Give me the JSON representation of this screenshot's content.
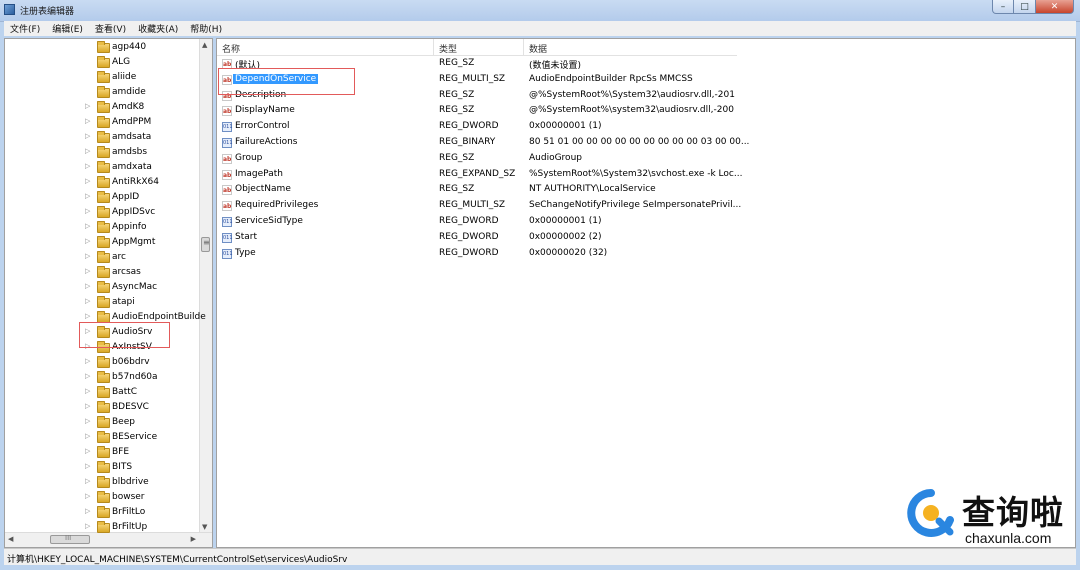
{
  "window": {
    "title": "注册表编辑器",
    "min_symbol": "–",
    "max_symbol": "□",
    "close_symbol": "✕"
  },
  "menu": [
    "文件(F)",
    "编辑(E)",
    "查看(V)",
    "收藏夹(A)",
    "帮助(H)"
  ],
  "tree": {
    "items": [
      {
        "label": "agp440",
        "expandable": false
      },
      {
        "label": "ALG",
        "expandable": false
      },
      {
        "label": "aliide",
        "expandable": false
      },
      {
        "label": "amdide",
        "expandable": false
      },
      {
        "label": "AmdK8",
        "expandable": true
      },
      {
        "label": "AmdPPM",
        "expandable": true
      },
      {
        "label": "amdsata",
        "expandable": true
      },
      {
        "label": "amdsbs",
        "expandable": true
      },
      {
        "label": "amdxata",
        "expandable": true
      },
      {
        "label": "AntiRkX64",
        "expandable": true
      },
      {
        "label": "AppID",
        "expandable": true
      },
      {
        "label": "AppIDSvc",
        "expandable": true
      },
      {
        "label": "Appinfo",
        "expandable": true
      },
      {
        "label": "AppMgmt",
        "expandable": true
      },
      {
        "label": "arc",
        "expandable": true
      },
      {
        "label": "arcsas",
        "expandable": true
      },
      {
        "label": "AsyncMac",
        "expandable": true
      },
      {
        "label": "atapi",
        "expandable": true
      },
      {
        "label": "AudioEndpointBuilde",
        "expandable": true
      },
      {
        "label": "AudioSrv",
        "expandable": true
      },
      {
        "label": "AxInstSV",
        "expandable": true
      },
      {
        "label": "b06bdrv",
        "expandable": true
      },
      {
        "label": "b57nd60a",
        "expandable": true
      },
      {
        "label": "BattC",
        "expandable": true
      },
      {
        "label": "BDESVC",
        "expandable": true
      },
      {
        "label": "Beep",
        "expandable": true
      },
      {
        "label": "BEService",
        "expandable": true
      },
      {
        "label": "BFE",
        "expandable": true
      },
      {
        "label": "BITS",
        "expandable": true
      },
      {
        "label": "blbdrive",
        "expandable": true
      },
      {
        "label": "bowser",
        "expandable": true
      },
      {
        "label": "BrFiltLo",
        "expandable": true
      },
      {
        "label": "BrFiltUp",
        "expandable": true
      }
    ],
    "scroll_up": "▲",
    "scroll_down": "▼",
    "scroll_left": "◀",
    "scroll_right": "▶"
  },
  "values": {
    "columns": [
      "名称",
      "类型",
      "数据"
    ],
    "rows": [
      {
        "name": "(默认)",
        "type": "REG_SZ",
        "data": "(数值未设置)",
        "icon": "ab"
      },
      {
        "name": "DependOnService",
        "type": "REG_MULTI_SZ",
        "data": "AudioEndpointBuilder RpcSs MMCSS",
        "icon": "ab"
      },
      {
        "name": "Description",
        "type": "REG_SZ",
        "data": "@%SystemRoot%\\System32\\audiosrv.dll,-201",
        "icon": "ab"
      },
      {
        "name": "DisplayName",
        "type": "REG_SZ",
        "data": "@%SystemRoot%\\system32\\audiosrv.dll,-200",
        "icon": "ab"
      },
      {
        "name": "ErrorControl",
        "type": "REG_DWORD",
        "data": "0x00000001 (1)",
        "icon": "bin"
      },
      {
        "name": "FailureActions",
        "type": "REG_BINARY",
        "data": "80 51 01 00 00 00 00 00 00 00 00 00 03 00 00...",
        "icon": "bin"
      },
      {
        "name": "Group",
        "type": "REG_SZ",
        "data": "AudioGroup",
        "icon": "ab"
      },
      {
        "name": "ImagePath",
        "type": "REG_EXPAND_SZ",
        "data": "%SystemRoot%\\System32\\svchost.exe -k Loc...",
        "icon": "ab"
      },
      {
        "name": "ObjectName",
        "type": "REG_SZ",
        "data": "NT AUTHORITY\\LocalService",
        "icon": "ab"
      },
      {
        "name": "RequiredPrivileges",
        "type": "REG_MULTI_SZ",
        "data": "SeChangeNotifyPrivilege SeImpersonatePrivil...",
        "icon": "ab"
      },
      {
        "name": "ServiceSidType",
        "type": "REG_DWORD",
        "data": "0x00000001 (1)",
        "icon": "bin"
      },
      {
        "name": "Start",
        "type": "REG_DWORD",
        "data": "0x00000002 (2)",
        "icon": "bin"
      },
      {
        "name": "Type",
        "type": "REG_DWORD",
        "data": "0x00000020 (32)",
        "icon": "bin"
      }
    ]
  },
  "status": "计算机\\HKEY_LOCAL_MACHINE\\SYSTEM\\CurrentControlSet\\services\\AudioSrv",
  "watermark": {
    "cn": "查询啦",
    "en": "chaxunla.com"
  },
  "colors": {
    "selection": "#3399ff",
    "highlight_box": "#e25a5a",
    "title_bar": "#c9dbf2"
  }
}
